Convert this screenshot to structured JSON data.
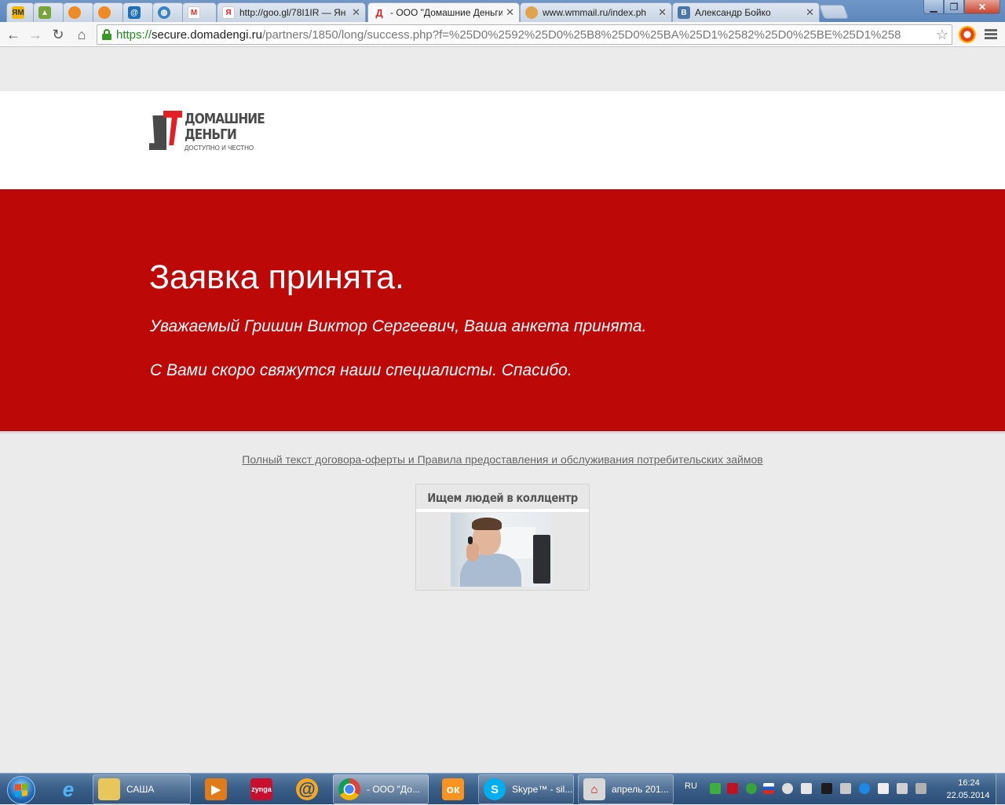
{
  "browser": {
    "tabs": [
      {
        "label": "",
        "favicon": "yandex-market-icon",
        "color": "#f2b705"
      },
      {
        "label": "",
        "favicon": "image-icon",
        "color": "#7aa33b"
      },
      {
        "label": "",
        "favicon": "firefox-like-icon",
        "color": "#f08a24"
      },
      {
        "label": "",
        "favicon": "firefox-like-icon",
        "color": "#f08a24"
      },
      {
        "label": "",
        "favicon": "mail-ru-at-icon",
        "color": "#1d6fb8"
      },
      {
        "label": "",
        "favicon": "globe-icon",
        "color": "#3b82c4"
      },
      {
        "label": "",
        "favicon": "gmail-icon",
        "color": "#d93025"
      },
      {
        "label": "http://goo.gl/78I1IR — Ян",
        "favicon": "yandex-icon",
        "color": "#e22"
      },
      {
        "label": "- ООО \"Домашние Деньги",
        "favicon": "domadengi-icon",
        "color": "#e31e24"
      },
      {
        "label": "www.wmmail.ru/index.ph",
        "favicon": "wmmail-icon",
        "color": "#e0a44c"
      },
      {
        "label": "Александр Бойко",
        "favicon": "vk-icon",
        "color": "#4a76a8"
      }
    ],
    "url": {
      "scheme": "https://",
      "host": "secure.domadengi.ru",
      "path": "/partners/1850/long/success.php?f=%25D0%2592%25D0%25B8%25D0%25BA%25D1%2582%25D0%25BE%25D1%258"
    }
  },
  "page": {
    "logo": {
      "line1": "ДОМАШНИЕ",
      "line2": "ДЕНЬГИ",
      "tagline": "ДОСТУПНО И ЧЕСТНО"
    },
    "banner": {
      "title": "Заявка принята.",
      "line1": "Уважаемый Гришин Виктор Сергеевич, Ваша анкета принята.",
      "line2": "С Вами скоро свяжутся наши специалисты. Спасибо."
    },
    "offer_link": "Полный текст договора-оферты и Правила предоставления и обслуживания потребительских займов",
    "ad": {
      "title": "Ищем людей в коллцентр"
    }
  },
  "taskbar": {
    "items": [
      {
        "label": "",
        "icon": "ie-icon"
      },
      {
        "label": "САША",
        "icon": "folder-icon"
      },
      {
        "label": "",
        "icon": "media-player-icon"
      },
      {
        "label": "",
        "icon": "zynga-icon"
      },
      {
        "label": "",
        "icon": "mail-agent-icon"
      },
      {
        "label": "- ООО \"До...",
        "icon": "chrome-icon"
      },
      {
        "label": "",
        "icon": "odnoklassniki-icon"
      },
      {
        "label": "Skype™ - sil...",
        "icon": "skype-icon"
      },
      {
        "label": "апрель 201...",
        "icon": "game-icon"
      }
    ],
    "language": "RU",
    "time": "16:24",
    "date": "22.05.2014"
  },
  "colors": {
    "banner_red": "#bd0808",
    "logo_red": "#e31e24",
    "logo_gray": "#4a4a4a"
  }
}
